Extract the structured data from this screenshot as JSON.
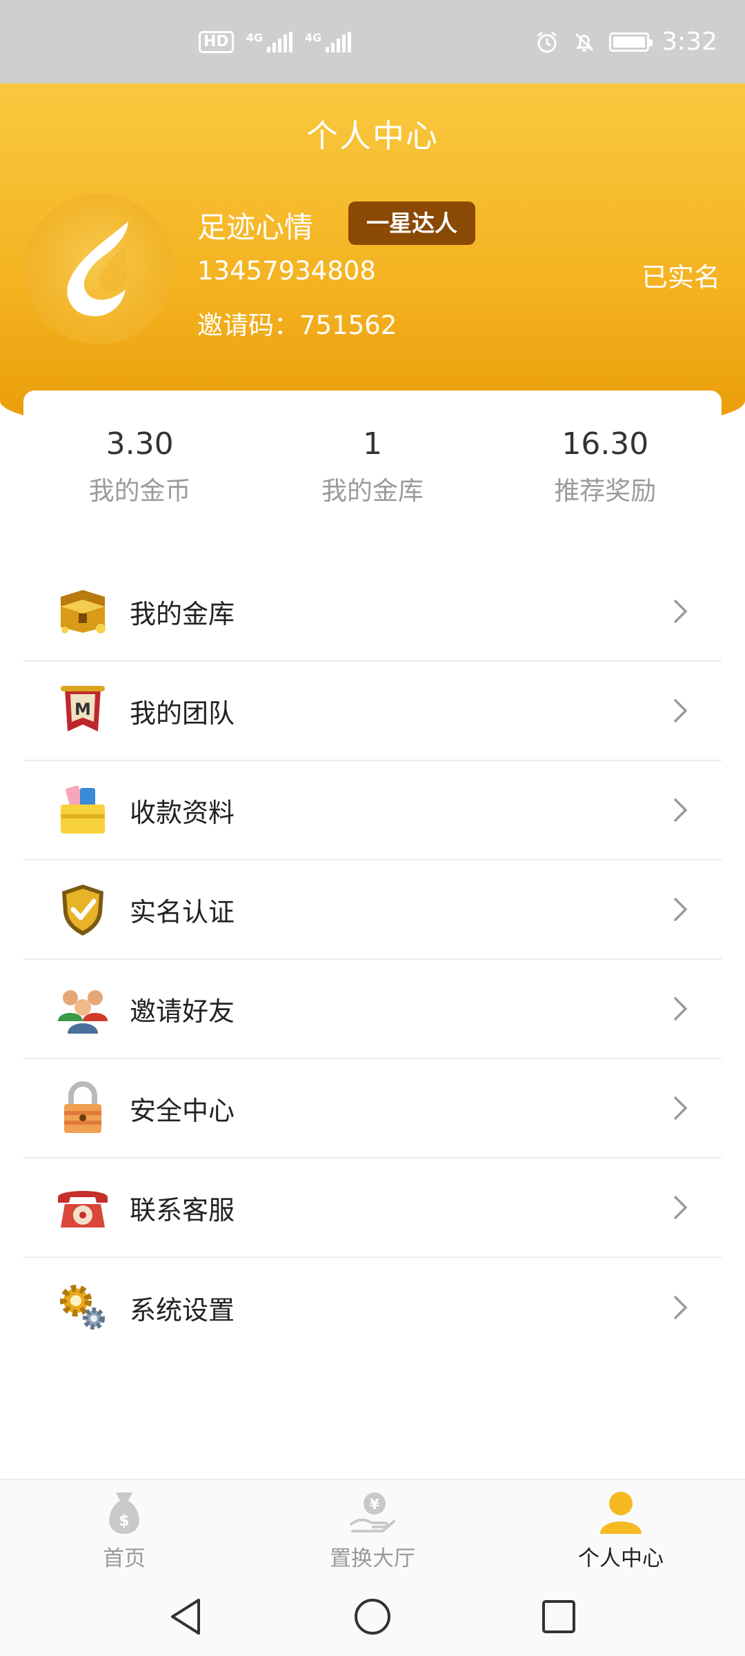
{
  "status_bar": {
    "hd": "HD",
    "network_1": "4G",
    "network_2": "4G",
    "time": "3:32"
  },
  "header": {
    "title": "个人中心",
    "username": "足迹心情",
    "level_badge": "一星达人",
    "phone": "13457934808",
    "invite_code": "邀请码：751562",
    "verified_status": "已实名"
  },
  "stats": [
    {
      "value": "3.30",
      "label": "我的金币"
    },
    {
      "value": "1",
      "label": "我的金库"
    },
    {
      "value": "16.30",
      "label": "推荐奖励"
    }
  ],
  "menu": [
    {
      "label": "我的金库",
      "icon": "treasure-chest-icon"
    },
    {
      "label": "我的团队",
      "icon": "team-banner-icon"
    },
    {
      "label": "收款资料",
      "icon": "wallet-cards-icon"
    },
    {
      "label": "实名认证",
      "icon": "shield-check-icon"
    },
    {
      "label": "邀请好友",
      "icon": "friends-icon"
    },
    {
      "label": "安全中心",
      "icon": "padlock-icon"
    },
    {
      "label": "联系客服",
      "icon": "telephone-icon"
    },
    {
      "label": "系统设置",
      "icon": "gears-icon"
    }
  ],
  "tabs": [
    {
      "label": "首页",
      "icon": "money-bag-icon",
      "active": false
    },
    {
      "label": "置换大厅",
      "icon": "hand-coin-icon",
      "active": false
    },
    {
      "label": "个人中心",
      "icon": "person-icon",
      "active": true
    }
  ],
  "colors": {
    "header_top": "#f9c83f",
    "header_bottom": "#e99a06",
    "badge_bg": "#8a4a06",
    "active_tab_icon": "#f5b921"
  }
}
